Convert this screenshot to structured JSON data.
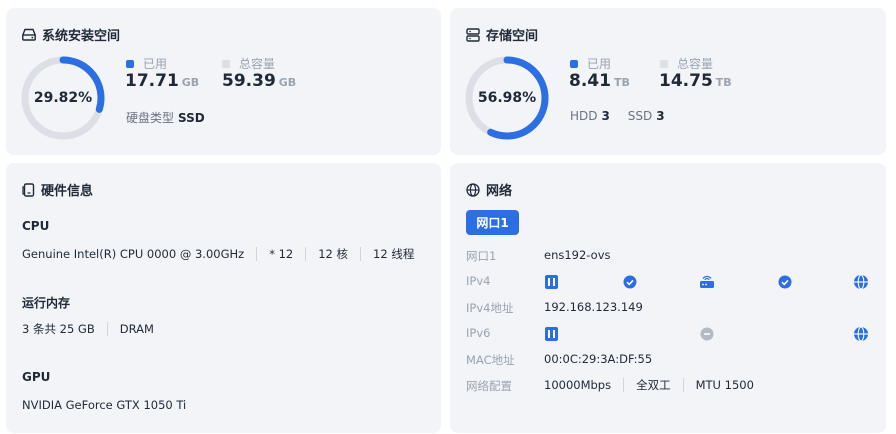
{
  "system_space": {
    "title": "系统安装空间",
    "percent_label": "29.82%",
    "percent": 0.2982,
    "used_label": "已用",
    "used_value": "17.71",
    "used_unit": "GB",
    "total_label": "总容量",
    "total_value": "59.39",
    "total_unit": "GB",
    "disk_type_label": "硬盘类型",
    "disk_type_value": "SSD"
  },
  "storage_space": {
    "title": "存储空间",
    "percent_label": "56.98%",
    "percent": 0.5698,
    "used_label": "已用",
    "used_value": "8.41",
    "used_unit": "TB",
    "total_label": "总容量",
    "total_value": "14.75",
    "total_unit": "TB",
    "hdd_label": "HDD",
    "hdd_count": "3",
    "ssd_label": "SSD",
    "ssd_count": "3"
  },
  "hardware": {
    "title": "硬件信息",
    "cpu_label": "CPU",
    "cpu_model": "Genuine Intel(R) CPU 0000 @ 3.00GHz",
    "cpu_count": "* 12",
    "cpu_cores": "12 核",
    "cpu_threads": "12 线程",
    "memory_label": "运行内存",
    "memory_size": "3 条共 25 GB",
    "memory_type": "DRAM",
    "gpu_label": "GPU",
    "gpu_model": "NVIDIA GeForce GTX 1050 Ti"
  },
  "network": {
    "title": "网络",
    "tab": "网口1",
    "port_label": "网口1",
    "port_value": "ens192-ovs",
    "ipv4_label": "IPv4",
    "ipv4_addr_label": "IPv4地址",
    "ipv4_addr_value": "192.168.123.149",
    "ipv6_label": "IPv6",
    "mac_label": "MAC地址",
    "mac_value": "00:0C:29:3A:DF:55",
    "config_label": "网络配置",
    "config_speed": "10000Mbps",
    "config_duplex": "全双工",
    "config_mtu": "MTU 1500"
  },
  "colors": {
    "accent": "#2b6fe3",
    "track": "#dcdfe5",
    "card_bg": "#f2f4f8"
  }
}
